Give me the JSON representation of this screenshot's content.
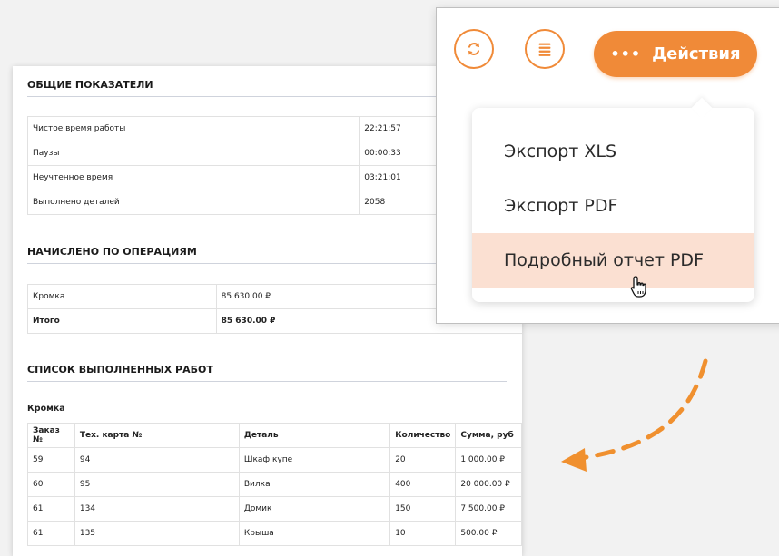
{
  "report": {
    "general": {
      "title": "ОБЩИЕ ПОКАЗАТЕЛИ",
      "rows": [
        {
          "label": "Чистое время работы",
          "value": "22:21:57"
        },
        {
          "label": "Паузы",
          "value": "00:00:33"
        },
        {
          "label": "Неучтенное время",
          "value": "03:21:01"
        },
        {
          "label": "Выполнено деталей",
          "value": "2058"
        }
      ]
    },
    "accrued": {
      "title": "НАЧИСЛЕНО ПО ОПЕРАЦИЯМ",
      "rows": [
        {
          "label": "Кромка",
          "value": "85 630.00 ₽"
        },
        {
          "label": "Итого",
          "value": "85 630.00 ₽"
        }
      ]
    },
    "works": {
      "title": "СПИСОК ВЫПОЛНЕННЫХ РАБОТ",
      "subtitle": "Кромка",
      "columns": [
        "Заказ №",
        "Тех. карта №",
        "Деталь",
        "Количество",
        "Сумма, руб"
      ],
      "rows": [
        [
          "59",
          "94",
          "Шкаф купе",
          "20",
          "1 000.00 ₽"
        ],
        [
          "60",
          "95",
          "Вилка",
          "400",
          "20 000.00 ₽"
        ],
        [
          "61",
          "134",
          "Домик",
          "150",
          "7 500.00 ₽"
        ],
        [
          "61",
          "135",
          "Крыша",
          "10",
          "500.00 ₽"
        ]
      ]
    }
  },
  "panel": {
    "actions_label": "Действия",
    "actions_dots": "•••",
    "icons": {
      "refresh": "refresh-icon",
      "list": "list-icon",
      "cursor": "hand-pointer-icon"
    },
    "menu": [
      {
        "label": "Экспорт XLS"
      },
      {
        "label": "Экспорт PDF"
      },
      {
        "label": "Подробный отчет PDF"
      }
    ]
  },
  "colors": {
    "accent": "#f08a38",
    "highlight": "#fbe0d2",
    "arrow": "#f0902f"
  }
}
